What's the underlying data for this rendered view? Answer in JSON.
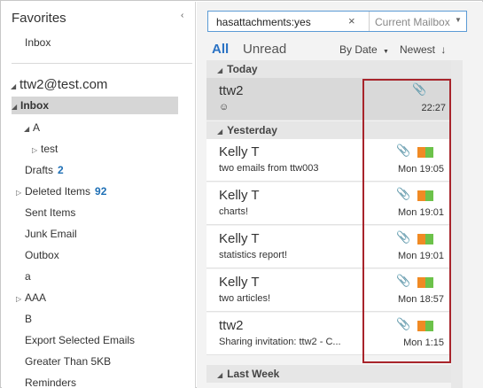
{
  "folder_pane": {
    "favorites_header": "Favorites",
    "favorites": [
      {
        "label": "Inbox"
      }
    ],
    "account": "ttw2@test.com",
    "folders": [
      {
        "label": "Inbox",
        "count": ""
      },
      {
        "label": "A",
        "count": ""
      },
      {
        "label": "test",
        "count": ""
      },
      {
        "label": "Drafts",
        "count": "2"
      },
      {
        "label": "Deleted Items",
        "count": "92"
      },
      {
        "label": "Sent Items",
        "count": ""
      },
      {
        "label": "Junk Email",
        "count": ""
      },
      {
        "label": "Outbox",
        "count": ""
      },
      {
        "label": "a",
        "count": ""
      },
      {
        "label": "AAA",
        "count": ""
      },
      {
        "label": "B",
        "count": ""
      },
      {
        "label": "Export Selected Emails",
        "count": ""
      },
      {
        "label": "Greater Than 5KB",
        "count": ""
      },
      {
        "label": "Reminders",
        "count": ""
      }
    ]
  },
  "search": {
    "query": "hasattachments:yes",
    "clear_icon": "×",
    "scope": "Current Mailbox"
  },
  "filters": {
    "all": "All",
    "unread": "Unread",
    "sort_by": "By Date",
    "order": "Newest"
  },
  "groups": [
    {
      "label": "Today"
    },
    {
      "label": "Yesterday"
    },
    {
      "label": "Last Week"
    }
  ],
  "mails": [
    {
      "sender": "ttw2",
      "subject": "☺",
      "time": "22:27",
      "has_category": false,
      "selected": true
    },
    {
      "sender": "Kelly T",
      "subject": "two emails from ttw003",
      "time": "Mon 19:05",
      "has_category": true,
      "selected": false
    },
    {
      "sender": "Kelly T",
      "subject": "charts!",
      "time": "Mon 19:01",
      "has_category": true,
      "selected": false
    },
    {
      "sender": "Kelly T",
      "subject": "statistics report!",
      "time": "Mon 19:01",
      "has_category": true,
      "selected": false
    },
    {
      "sender": "Kelly T",
      "subject": "two articles!",
      "time": "Mon 18:57",
      "has_category": true,
      "selected": false
    },
    {
      "sender": "ttw2",
      "subject": "Sharing invitation: ttw2 - C...",
      "time": "Mon 1:15",
      "has_category": true,
      "selected": false
    }
  ],
  "colors": {
    "accent": "#2a72c4",
    "highlight_border": "#a8242b",
    "category_orange": "#f08a24",
    "category_green": "#6cc24a"
  }
}
